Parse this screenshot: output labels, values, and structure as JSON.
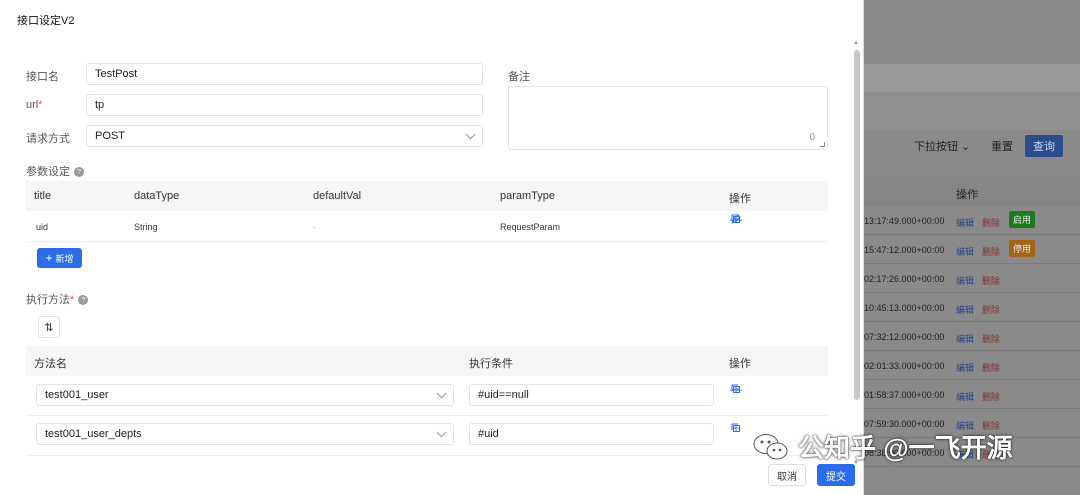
{
  "drawer": {
    "title": "接口设定V2",
    "name_label": "接口名",
    "name_value": "TestPost",
    "url_label": "url",
    "url_required": "*",
    "url_value": "tp",
    "method_label": "请求方式",
    "method_value": "POST",
    "remark_label": "备注",
    "remark_count": "0"
  },
  "params": {
    "section_label": "参数设定",
    "columns": [
      "title",
      "dataType",
      "defaultVal",
      "paramType",
      "操作"
    ],
    "rows": [
      {
        "title": "uid",
        "dataType": "String",
        "defaultVal": "-",
        "paramType": "RequestParam"
      }
    ],
    "add_label": "新增"
  },
  "exec": {
    "section_label": "执行方法",
    "required": "*",
    "sort_icon": "⇅",
    "columns": [
      "方法名",
      "执行条件",
      "操作"
    ],
    "rows": [
      {
        "method": "test001_user",
        "condition": "#uid==null"
      },
      {
        "method": "test001_user_depts",
        "condition": "#uid"
      }
    ]
  },
  "footer": {
    "cancel_label": "取消",
    "submit_label": "提交"
  },
  "background": {
    "dropdown_label": "下拉按钮",
    "reset_label": "重置",
    "query_label": "查询",
    "column_label": "操作",
    "edit_label": "编辑",
    "delete_label": "删除",
    "rows": [
      {
        "time": "13:17:49.000+00:00",
        "tag": "启用",
        "tag_color": "#1f7a1f"
      },
      {
        "time": "15:47:12.000+00:00",
        "tag": "停用",
        "tag_color": "#a36417"
      },
      {
        "time": "02:17:26.000+00:00",
        "tag": ""
      },
      {
        "time": "10:45:13.000+00:00",
        "tag": ""
      },
      {
        "time": "07:32:12.000+00:00",
        "tag": ""
      },
      {
        "time": "02:01:33.000+00:00",
        "tag": ""
      },
      {
        "time": "01:58:37.000+00:00",
        "tag": ""
      },
      {
        "time": "07:59:30.000+00:00",
        "tag": ""
      },
      {
        "time": "08:38:00.000+00:00",
        "tag": ""
      }
    ]
  },
  "watermark": {
    "text": "公知乎 @一飞开源"
  },
  "colors": {
    "primary": "#2b6de8",
    "icon_blue": "#2f6df6"
  }
}
